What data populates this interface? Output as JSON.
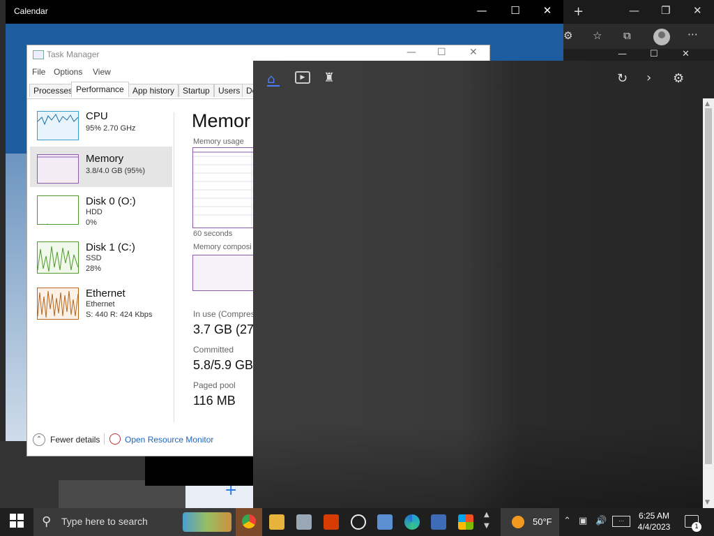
{
  "calendar": {
    "title": "Calendar"
  },
  "task_manager": {
    "title": "Task Manager",
    "menu": [
      "File",
      "Options",
      "View"
    ],
    "tabs": [
      "Processes",
      "Performance",
      "App history",
      "Startup",
      "Users",
      "De"
    ],
    "sidebar": [
      {
        "name": "CPU",
        "line1": "95%  2.70 GHz",
        "line2": "",
        "line3": ""
      },
      {
        "name": "Memory",
        "line1": "3.8/4.0 GB (95%)",
        "line2": "",
        "line3": ""
      },
      {
        "name": "Disk 0 (O:)",
        "line1": "HDD",
        "line2": "0%",
        "line3": ""
      },
      {
        "name": "Disk 1 (C:)",
        "line1": "SSD",
        "line2": "28%",
        "line3": ""
      },
      {
        "name": "Ethernet",
        "line1": "Ethernet",
        "line2": "S: 440  R: 424 Kbps",
        "line3": ""
      }
    ],
    "detail": {
      "heading": "Memor",
      "usage_label": "Memory usage",
      "seconds_label": "60 seconds",
      "composition_label": "Memory composi",
      "in_use_label": "In use (Compress",
      "in_use_value": "3.7 GB (27",
      "committed_label": "Committed",
      "committed_value": "5.8/5.9 GB",
      "paged_label": "Paged pool",
      "paged_value": "116 MB"
    },
    "footer": {
      "fewer_details": "Fewer details",
      "open_resource_monitor": "Open Resource Monitor"
    }
  },
  "taskbar": {
    "search_placeholder": "Type here to search",
    "weather": "50°F",
    "time": "6:25 AM",
    "date": "4/4/2023",
    "notification_count": "1"
  }
}
